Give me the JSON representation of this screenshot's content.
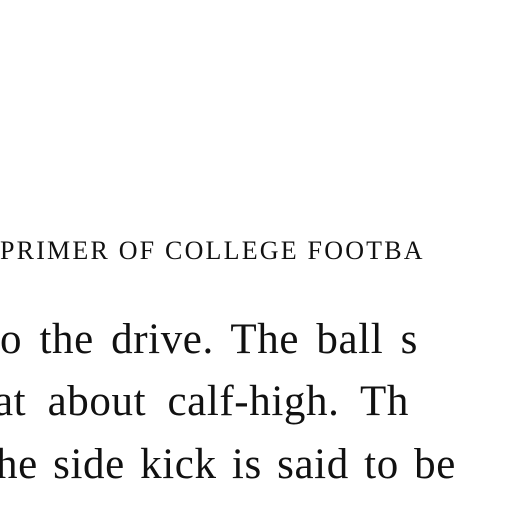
{
  "page": {
    "running_head": "PRIMER OF COLLEGE FOOTBA",
    "lines": [
      "o the drive.  The ball s",
      "at about calf-high.  Th",
      "he side kick is said to be"
    ]
  }
}
